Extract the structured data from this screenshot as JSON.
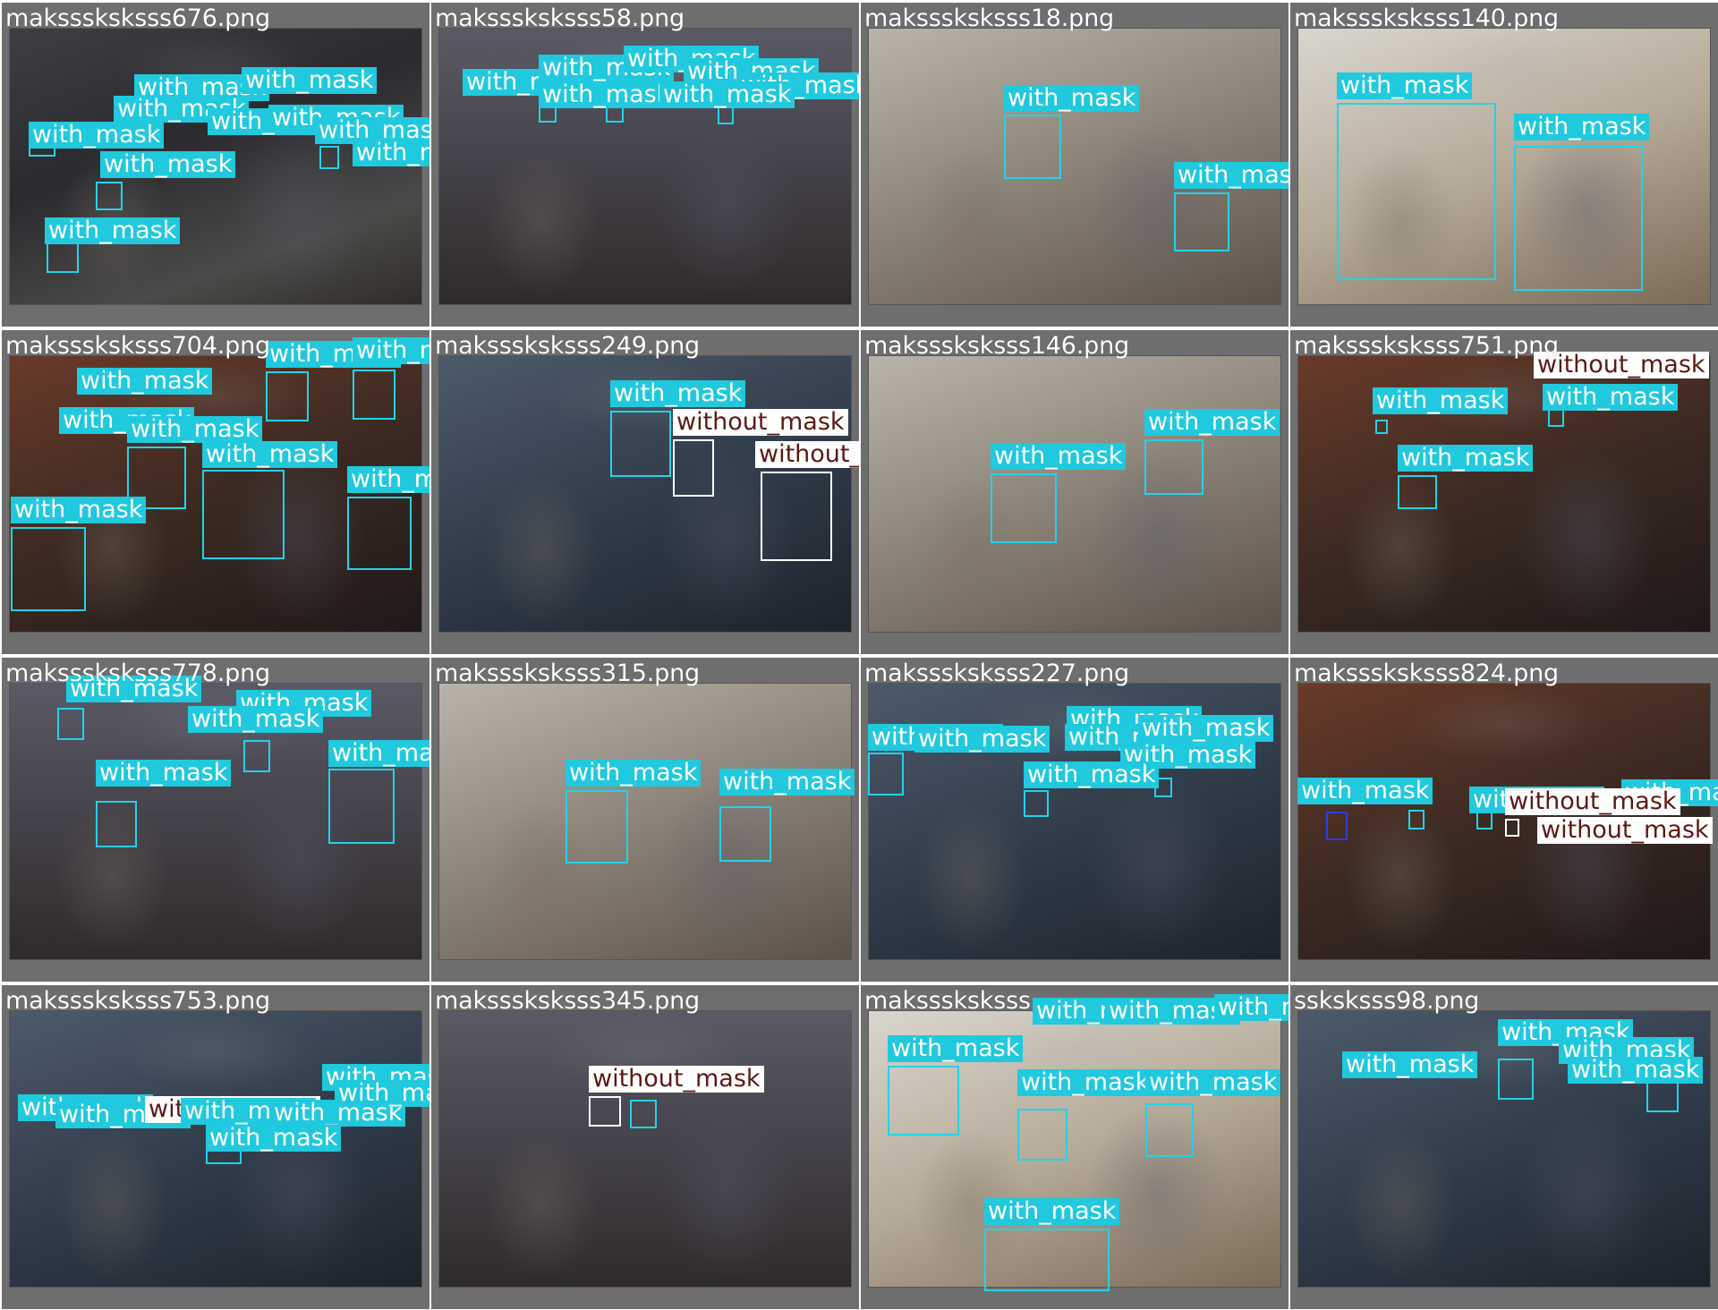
{
  "labels": {
    "mask": "with_mask",
    "nomask": "without_mask"
  },
  "colors": {
    "with_mask": "#20c9dd",
    "without_mask": "#ffffff",
    "background": "#6e6e6e"
  },
  "tiles": [
    {
      "file": "maksssksksss676.png",
      "with_mask_count": 12,
      "without_mask_count": 0
    },
    {
      "file": "maksssksksss58.png",
      "with_mask_count": 11,
      "without_mask_count": 0
    },
    {
      "file": "maksssksksss18.png",
      "with_mask_count": 2,
      "without_mask_count": 0
    },
    {
      "file": "maksssksksss140.png",
      "with_mask_count": 2,
      "without_mask_count": 0
    },
    {
      "file": "maksssksksss704.png",
      "with_mask_count": 9,
      "without_mask_count": 0
    },
    {
      "file": "maksssksksss249.png",
      "with_mask_count": 1,
      "without_mask_count": 2
    },
    {
      "file": "maksssksksss146.png",
      "with_mask_count": 2,
      "without_mask_count": 0
    },
    {
      "file": "maksssksksss751.png",
      "with_mask_count": 3,
      "without_mask_count": 1
    },
    {
      "file": "maksssksksss778.png",
      "with_mask_count": 5,
      "without_mask_count": 0
    },
    {
      "file": "maksssksksss315.png",
      "with_mask_count": 2,
      "without_mask_count": 0
    },
    {
      "file": "maksssksksss227.png",
      "with_mask_count": 9,
      "without_mask_count": 0
    },
    {
      "file": "maksssksksss824.png",
      "with_mask_count": 4,
      "without_mask_count": 2
    },
    {
      "file": "maksssksksss753.png",
      "with_mask_count": 8,
      "without_mask_count": 1
    },
    {
      "file": "maksssksksss345.png",
      "with_mask_count": 1,
      "without_mask_count": 1
    },
    {
      "file": "maksssksksss",
      "with_mask_count": 7,
      "without_mask_count": 0
    },
    {
      "file": "ssksksss98.png",
      "with_mask_count": 4,
      "without_mask_count": 0
    }
  ]
}
